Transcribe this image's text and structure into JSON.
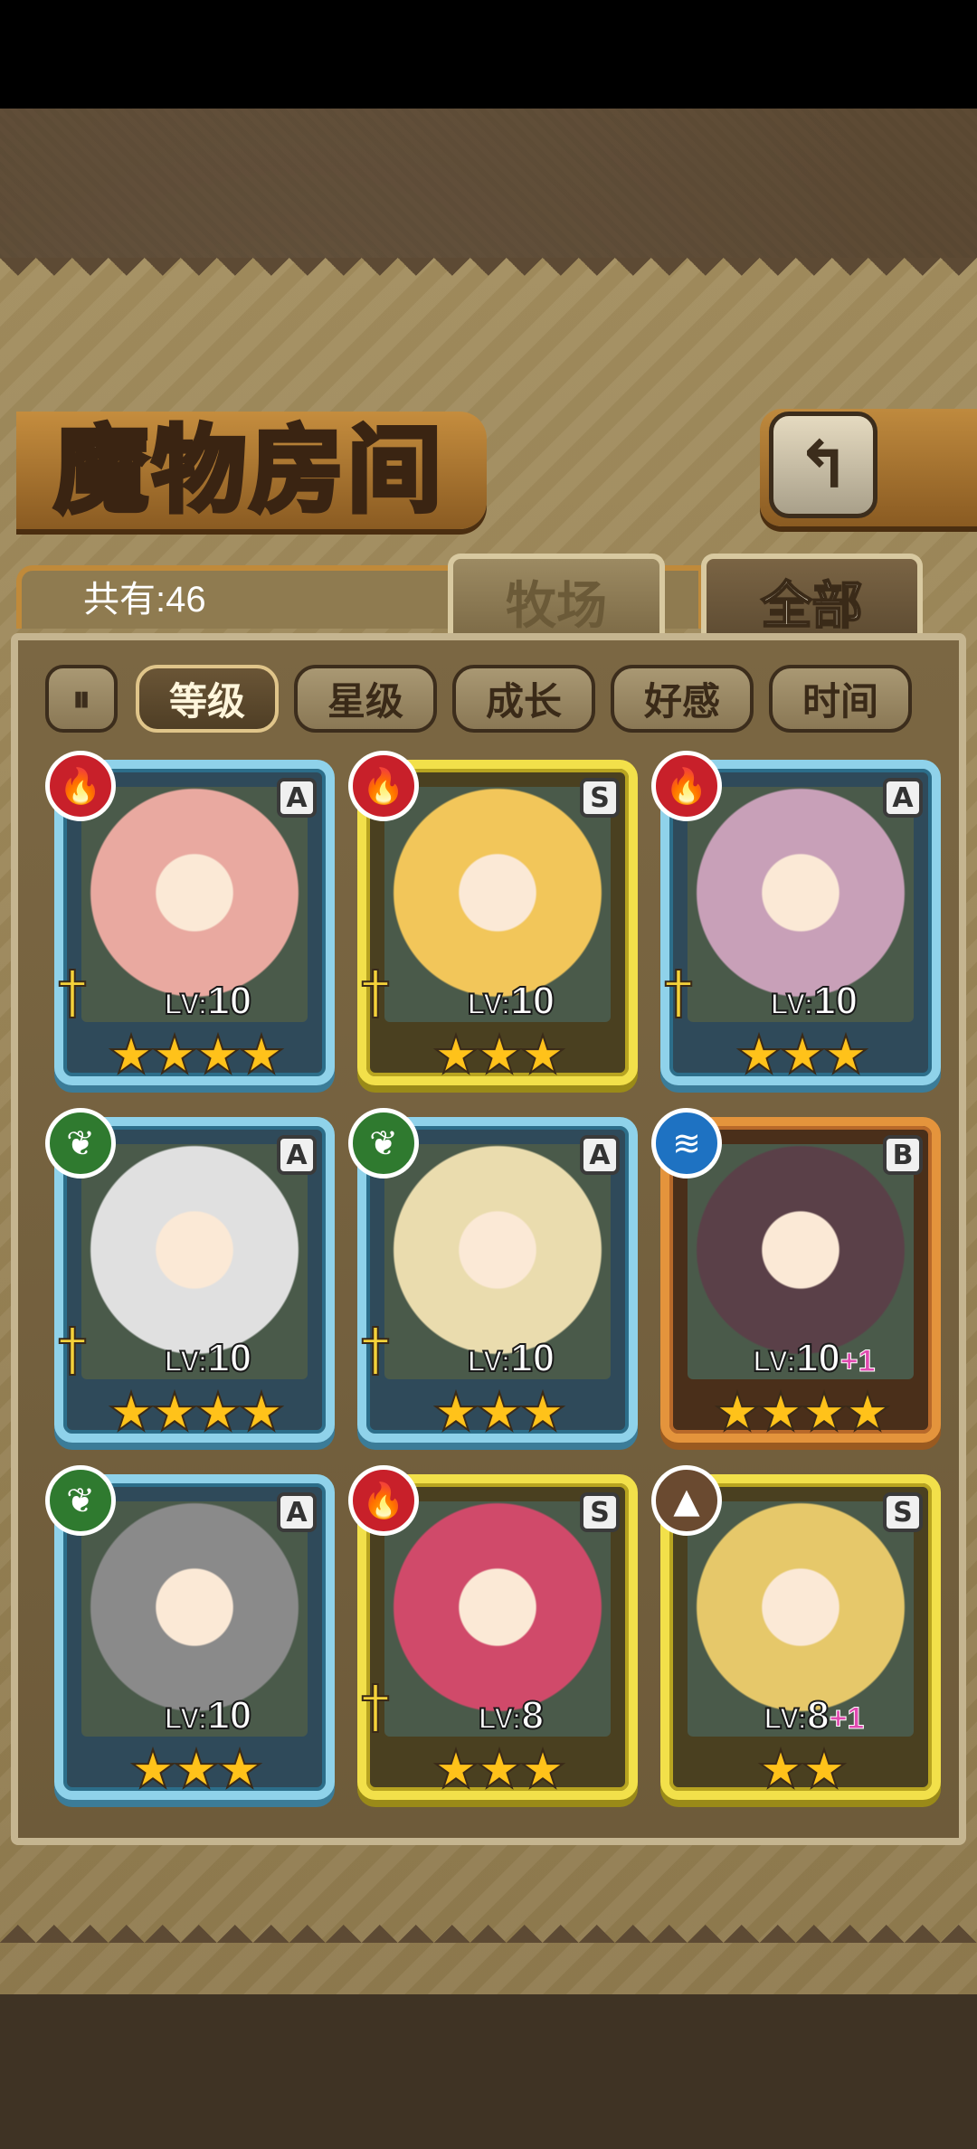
{
  "title": "魔物房间",
  "count_label": "共有:46",
  "tabs": [
    "牧场",
    "全部"
  ],
  "sort_buttons": [
    "等级",
    "星级",
    "成长",
    "好感",
    "时间"
  ],
  "icons": {
    "back": "return-arrow-icon",
    "sort_order": "sort-toggle-icon"
  },
  "colors": {
    "rank_A": "#8fd2ea",
    "rank_S": "#f2e04a",
    "rank_B": "#e4943c",
    "fire": "#c8202a",
    "leaf": "#2f7a2f",
    "water": "#1e72c2",
    "earth": "#6a4a30"
  },
  "monsters": [
    {
      "element": "fire",
      "rank": "A",
      "level": "10",
      "plus": "",
      "stars": 4,
      "weapon": true
    },
    {
      "element": "fire",
      "rank": "S",
      "level": "10",
      "plus": "",
      "stars": 3,
      "weapon": true
    },
    {
      "element": "fire",
      "rank": "A",
      "level": "10",
      "plus": "",
      "stars": 3,
      "weapon": true
    },
    {
      "element": "leaf",
      "rank": "A",
      "level": "10",
      "plus": "",
      "stars": 4,
      "weapon": true
    },
    {
      "element": "leaf",
      "rank": "A",
      "level": "10",
      "plus": "",
      "stars": 3,
      "weapon": true
    },
    {
      "element": "water",
      "rank": "B",
      "level": "10",
      "plus": "+1",
      "stars": 4,
      "weapon": false
    },
    {
      "element": "leaf",
      "rank": "A",
      "level": "10",
      "plus": "",
      "stars": 3,
      "weapon": false
    },
    {
      "element": "fire",
      "rank": "S",
      "level": "8",
      "plus": "",
      "stars": 3,
      "weapon": true
    },
    {
      "element": "earth",
      "rank": "S",
      "level": "8",
      "plus": "+1",
      "stars": 2,
      "weapon": false
    }
  ]
}
